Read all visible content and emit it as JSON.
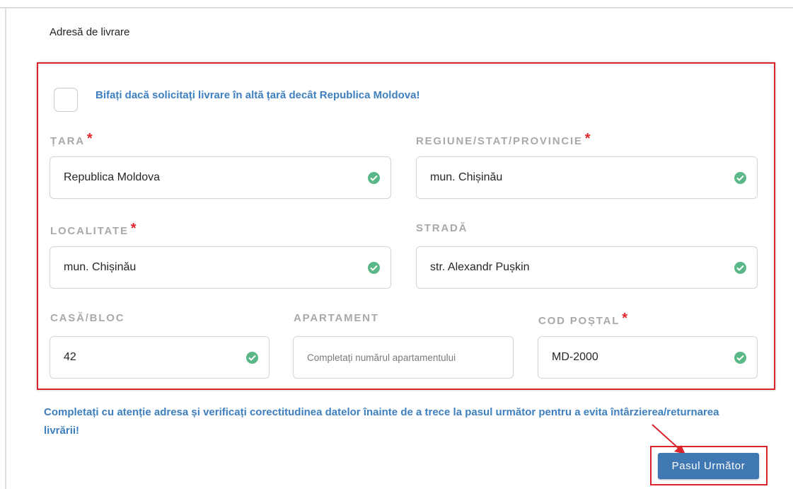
{
  "section": {
    "title": "Adresă de livrare"
  },
  "foreign_delivery": {
    "label": "Bifați dacă solicitați livrare în altă țară decât Republica Moldova!",
    "checked": false
  },
  "fields": {
    "country": {
      "label": "ȚARA",
      "required": "*",
      "value": "Republica Moldova"
    },
    "region": {
      "label": "REGIUNE/STAT/PROVINCIE",
      "required": "*",
      "value": "mun. Chișinău"
    },
    "locality": {
      "label": "LOCALITATE",
      "required": "*",
      "value": "mun. Chișinău"
    },
    "street": {
      "label": "STRADĂ",
      "value": "str. Alexandr Pușkin"
    },
    "house": {
      "label": "CASĂ/BLOC",
      "value": "42"
    },
    "apartment": {
      "label": "APARTAMENT",
      "value": "",
      "placeholder": "Completați numărul apartamentului"
    },
    "postal_code": {
      "label": "COD POȘTAL",
      "required": "*",
      "value": "MD-2000"
    }
  },
  "note": "Completați cu atenție adresa și verificați corectitudinea datelor înainte de a trece la pasul următor pentru a evita întârzierea/returnarea livrării!",
  "next_button": {
    "label": "Pasul Următor"
  },
  "colors": {
    "accent": "#3e7fbf",
    "button": "#3f78b3",
    "highlight": "#d9232d",
    "valid": "#5ab787",
    "required": "#e0262e"
  }
}
